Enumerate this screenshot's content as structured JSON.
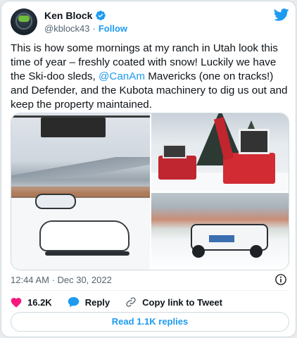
{
  "author": {
    "name": "Ken Block",
    "handle": "@kblock43",
    "separator": "·",
    "follow_label": "Follow"
  },
  "tweet": {
    "text_before": "This is how some mornings at my ranch in Utah look this time of year – freshly coated with snow! Luckily we have the Ski-doo sleds, ",
    "mention": "@CanAm",
    "text_after": " Mavericks (one on tracks!) and Defender, and the Kubota machinery to dig us out and keep the property maintained."
  },
  "meta": {
    "timestamp": "12:44 AM · Dec 30, 2022"
  },
  "actions": {
    "likes": "16.2K",
    "reply_label": "Reply",
    "copy_link_label": "Copy link to Tweet"
  },
  "read_replies_label": "Read 1.1K replies",
  "colors": {
    "accent": "#1d9bf0",
    "like": "#f91880",
    "text": "#0f1419",
    "muted": "#536471"
  },
  "icons": [
    "verified-badge-icon",
    "twitter-bird-icon",
    "info-icon",
    "heart-icon",
    "reply-bubble-icon",
    "link-icon"
  ]
}
